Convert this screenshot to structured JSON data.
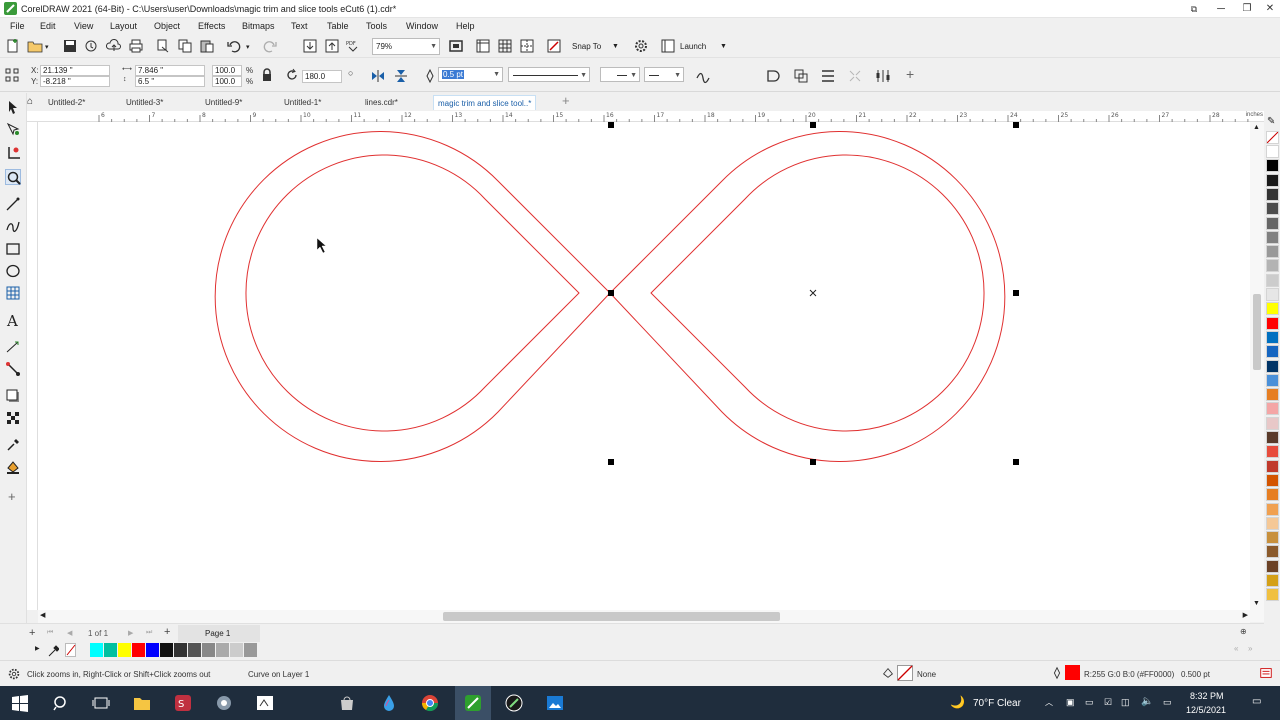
{
  "titlebar": {
    "title": "CorelDRAW 2021 (64-Bit) - C:\\Users\\user\\Downloads\\magic trim and slice tools eCut6 (1).cdr*",
    "minimize": "─",
    "maximize": "❐",
    "close": "✕"
  },
  "menu": [
    "File",
    "Edit",
    "View",
    "Layout",
    "Object",
    "Effects",
    "Bitmaps",
    "Text",
    "Table",
    "Tools",
    "Window",
    "Help"
  ],
  "standard": {
    "zoom": "79%",
    "snap_to": "Snap To",
    "launch": "Launch"
  },
  "property": {
    "x_label": "X:",
    "x_value": "21.139 \"",
    "y_label": "Y:",
    "y_value": "-8.218 \"",
    "width_value": "7.846 \"",
    "height_value": "6.5 \"",
    "scale_x": "100.0",
    "scale_y": "100.0",
    "percent": "%",
    "rotation": "180.0",
    "outline_width": "0.5 pt"
  },
  "doc_tabs": [
    "Untitled-2*",
    "Untitled-3*",
    "Untitled-9*",
    "Untitled-1*",
    "lines.cdr*",
    "magic trim and slice tool..*"
  ],
  "ruler": {
    "units": "inches",
    "ticks": [
      "6",
      "7",
      "8",
      "9",
      "10",
      "11",
      "12",
      "13",
      "14",
      "15",
      "16",
      "17",
      "18",
      "19",
      "20",
      "21",
      "22",
      "23",
      "24",
      "25",
      "26",
      "27",
      "28"
    ]
  },
  "pagebar": {
    "page_count": "1 of 1",
    "page_tab": "Page 1"
  },
  "status": {
    "hint": "Click zooms in, Right-Click or Shift+Click zooms out",
    "object_info": "Curve on Layer 1",
    "fill": "None",
    "outline_color_text": "R:255 G:0 B:0 (#FF0000)",
    "outline_width_text": "0.500 pt"
  },
  "taskbar": {
    "weather": "70°F  Clear",
    "time": "8:32 PM",
    "date": "12/5/2021"
  },
  "colors": {
    "accent": "#1a5fa8",
    "curve": "#e03030",
    "taskbar": "#1f2d3d"
  },
  "palette_colors": [
    "#ffffff",
    "#000000",
    "#1a1a1a",
    "#333333",
    "#4d4d4d",
    "#666666",
    "#808080",
    "#999999",
    "#b3b3b3",
    "#cccccc",
    "#e6e6e6",
    "#ffff00",
    "#ff0000",
    "#0070c0",
    "#1565c0",
    "#003366",
    "#4a90d9",
    "#e67e22",
    "#f4a6a6",
    "#e8c8c8",
    "#5a3a2a",
    "#e74c3c",
    "#c0392b",
    "#d35400",
    "#e67e22",
    "#f0a050",
    "#f5c896",
    "#c8903c",
    "#8b5a2b",
    "#6b4226",
    "#d4a017",
    "#f0c040"
  ],
  "doc_palette_colors": [
    "#00ffff",
    "#00c0a0",
    "#ffff00",
    "#ff0000",
    "#0000ff",
    "#111111",
    "#333333",
    "#555555",
    "#888888",
    "#aaaaaa",
    "#cccccc",
    "#999999"
  ]
}
